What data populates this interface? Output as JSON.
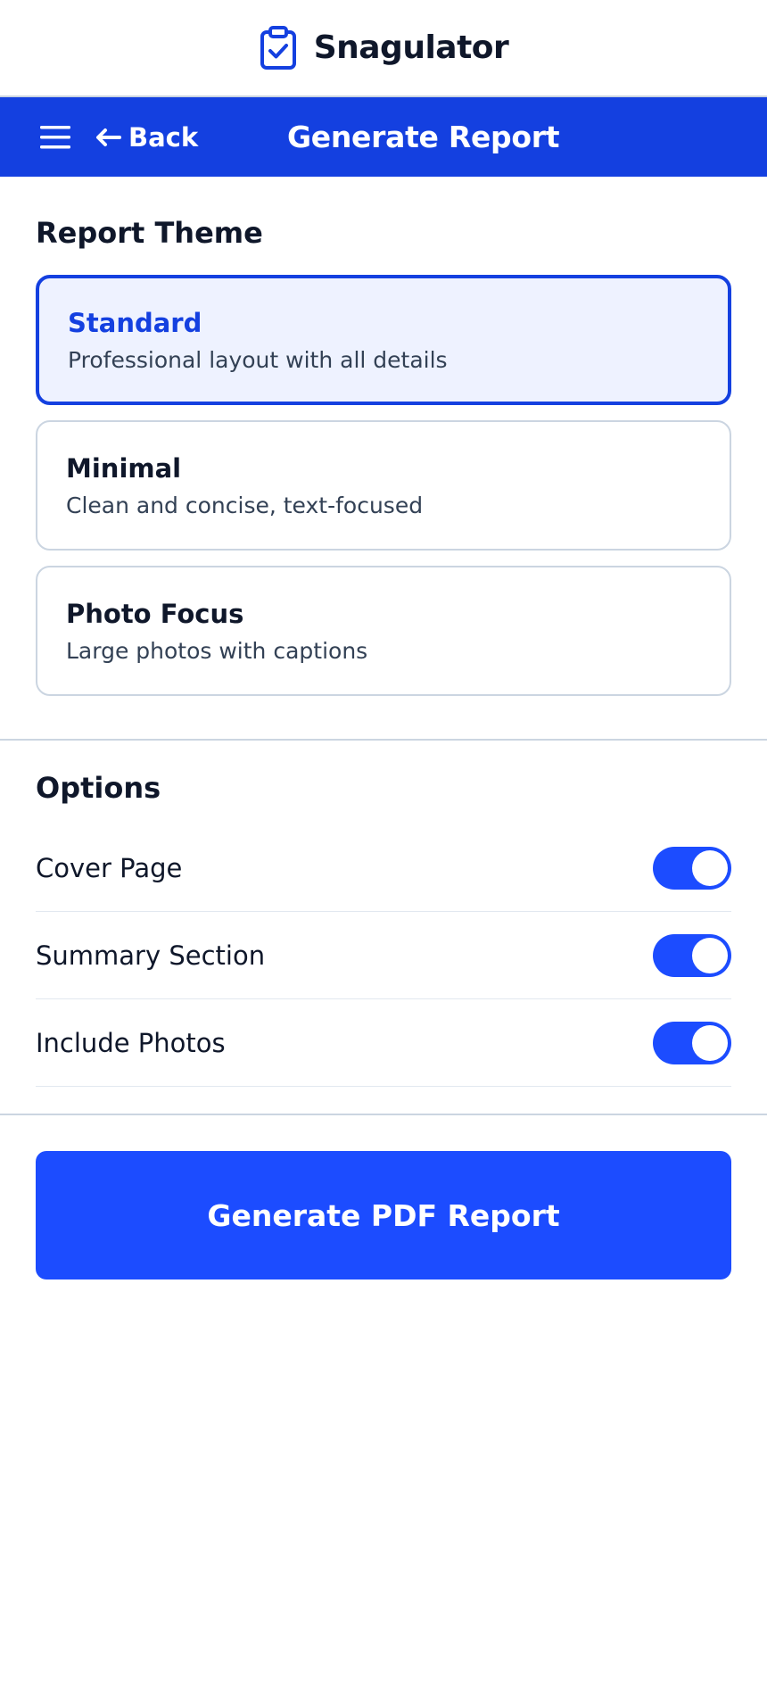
{
  "app": {
    "name": "Snagulator",
    "logo_icon": "clipboard-check-icon"
  },
  "nav": {
    "menu_icon": "hamburger-menu-icon",
    "back_label": "Back",
    "back_icon": "arrow-left-icon",
    "title": "Generate Report"
  },
  "theme": {
    "title": "Report Theme",
    "options": [
      {
        "name": "Standard",
        "description": "Professional layout with all details",
        "selected": true
      },
      {
        "name": "Minimal",
        "description": "Clean and concise, text-focused",
        "selected": false
      },
      {
        "name": "Photo Focus",
        "description": "Large photos with captions",
        "selected": false
      }
    ]
  },
  "options": {
    "title": "Options",
    "items": [
      {
        "label": "Cover Page",
        "enabled": true
      },
      {
        "label": "Summary Section",
        "enabled": true
      },
      {
        "label": "Include Photos",
        "enabled": true
      }
    ]
  },
  "action": {
    "generate_label": "Generate PDF Report"
  },
  "colors": {
    "brand": "#1440e0",
    "accent": "#1c4cff",
    "selected_bg": "#eef2ff",
    "border": "#cbd5e1"
  }
}
